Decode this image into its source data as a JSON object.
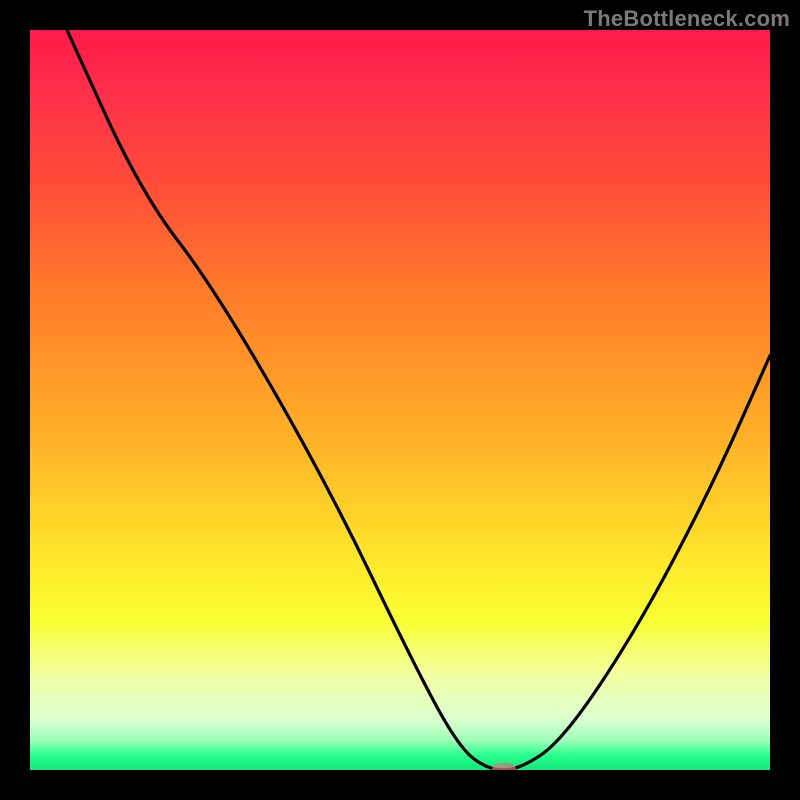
{
  "attribution": "TheBottleneck.com",
  "chart_data": {
    "type": "line",
    "title": "",
    "xlabel": "",
    "ylabel": "",
    "xlim": [
      0,
      100
    ],
    "ylim": [
      0,
      100
    ],
    "x": [
      5,
      15,
      25,
      40,
      52,
      58,
      62,
      66,
      72,
      82,
      92,
      100
    ],
    "values": [
      100,
      78,
      65,
      39,
      14,
      3,
      0,
      0,
      4,
      19,
      38,
      56
    ],
    "marker": {
      "x": 64,
      "y": 0
    },
    "background": "rainbow-gradient-red-to-green"
  }
}
